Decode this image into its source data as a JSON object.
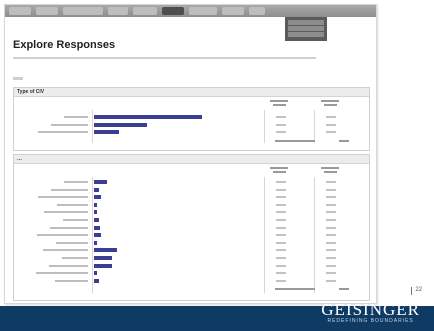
{
  "nav": {
    "tabs": [
      {
        "label": "…",
        "w": 22
      },
      {
        "label": "…",
        "w": 22
      },
      {
        "label": "…",
        "w": 40
      },
      {
        "label": "…",
        "w": 20
      },
      {
        "label": "…",
        "w": 24
      },
      {
        "label": "…",
        "w": 22
      },
      {
        "label": "…",
        "w": 28
      },
      {
        "label": "…",
        "w": 22
      },
      {
        "label": "…",
        "w": 16
      }
    ],
    "active_index": 5,
    "dropdown_items": [
      "…",
      "…",
      "…"
    ]
  },
  "page": {
    "title": "Explore Responses",
    "intro": "…",
    "small_label": "…"
  },
  "table1": {
    "question": "Type of CIV",
    "headers": {
      "percent": "Response Percent",
      "count": "Response Total"
    },
    "rows": [
      {
        "label": "…",
        "percent": 0.47,
        "percent_text": "…",
        "count": "…"
      },
      {
        "label": "…",
        "percent": 0.23,
        "percent_text": "…",
        "count": "…"
      },
      {
        "label": "…",
        "percent": 0.11,
        "percent_text": "…",
        "count": "…"
      }
    ],
    "total_label": "…",
    "total_value": "…"
  },
  "table2": {
    "question": "…",
    "headers": {
      "percent": "Response Percent",
      "count": "Response Total"
    },
    "rows": [
      {
        "label": "…",
        "percent": 0.11,
        "percent_text": "…",
        "count": "…"
      },
      {
        "label": "…",
        "percent": 0.04,
        "percent_text": "…",
        "count": "…"
      },
      {
        "label": "…",
        "percent": 0.06,
        "percent_text": "…",
        "count": "…"
      },
      {
        "label": "…",
        "percent": 0.02,
        "percent_text": "…",
        "count": "…"
      },
      {
        "label": "…",
        "percent": 0.01,
        "percent_text": "…",
        "count": "…"
      },
      {
        "label": "…",
        "percent": 0.04,
        "percent_text": "…",
        "count": "…"
      },
      {
        "label": "…",
        "percent": 0.05,
        "percent_text": "…",
        "count": "…"
      },
      {
        "label": "…",
        "percent": 0.06,
        "percent_text": "…",
        "count": "…"
      },
      {
        "label": "…",
        "percent": 0.02,
        "percent_text": "…",
        "count": "…"
      },
      {
        "label": "…",
        "percent": 0.19,
        "percent_text": "…",
        "count": "…"
      },
      {
        "label": "…",
        "percent": 0.15,
        "percent_text": "…",
        "count": "…"
      },
      {
        "label": "…",
        "percent": 0.15,
        "percent_text": "…",
        "count": "…"
      },
      {
        "label": "…",
        "percent": 0.01,
        "percent_text": "…",
        "count": "…"
      },
      {
        "label": "…",
        "percent": 0.04,
        "percent_text": "…",
        "count": "…"
      }
    ],
    "total_label": "…",
    "total_value": "…"
  },
  "brand": {
    "name": "GEISINGER",
    "tagline": "REDEFINING BOUNDARIES",
    "color_footer": "#0f3a64",
    "color_bar": "#3b3f93"
  },
  "slide": {
    "page_number": "22"
  }
}
